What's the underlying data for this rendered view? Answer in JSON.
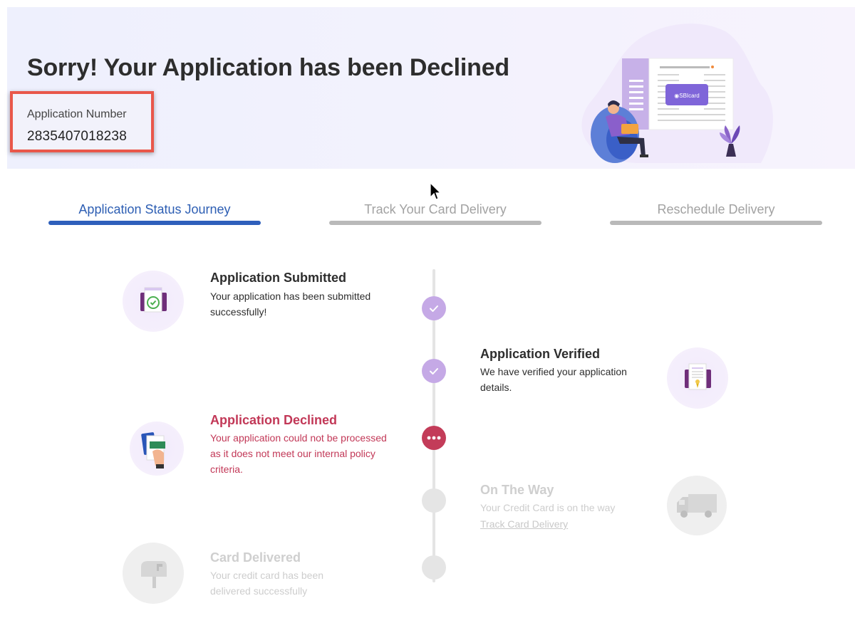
{
  "banner": {
    "title": "Sorry! Your Application has been Declined",
    "app_number_label": "Application Number",
    "app_number_value": "2835407018238",
    "brand_text": "SBI card"
  },
  "tabs": [
    {
      "label": "Application Status Journey",
      "active": true
    },
    {
      "label": "Track Your Card Delivery",
      "active": false
    },
    {
      "label": "Reschedule Delivery",
      "active": false
    }
  ],
  "steps": [
    {
      "title": "Application Submitted",
      "desc_line1": "Your application has been submitted",
      "desc_line2": "successfully!",
      "status": "done",
      "icon": "document-check-icon"
    },
    {
      "title": "Application Verified",
      "desc_line1": "We have verified your application",
      "desc_line2": "details.",
      "status": "done",
      "icon": "verified-document-icon"
    },
    {
      "title": "Application Declined",
      "desc_line1": "Your application could not be processed",
      "desc_line2": "as it does not meet our internal policy",
      "desc_line3": "criteria.",
      "status": "declined",
      "icon": "declined-cards-icon"
    },
    {
      "title": "On The Way",
      "desc_line1": "Your Credit Card is on the way",
      "link": "Track Card Delivery",
      "status": "pending",
      "icon": "delivery-truck-icon"
    },
    {
      "title": "Card Delivered",
      "desc_line1": "Your credit card has been",
      "desc_line2": "delivered successfully",
      "status": "pending",
      "icon": "mailbox-icon"
    }
  ],
  "colors": {
    "active_tab": "#2e5fbb",
    "declined": "#c23857",
    "done_node": "#c5a9e6",
    "highlight_box": "#e9574a"
  }
}
